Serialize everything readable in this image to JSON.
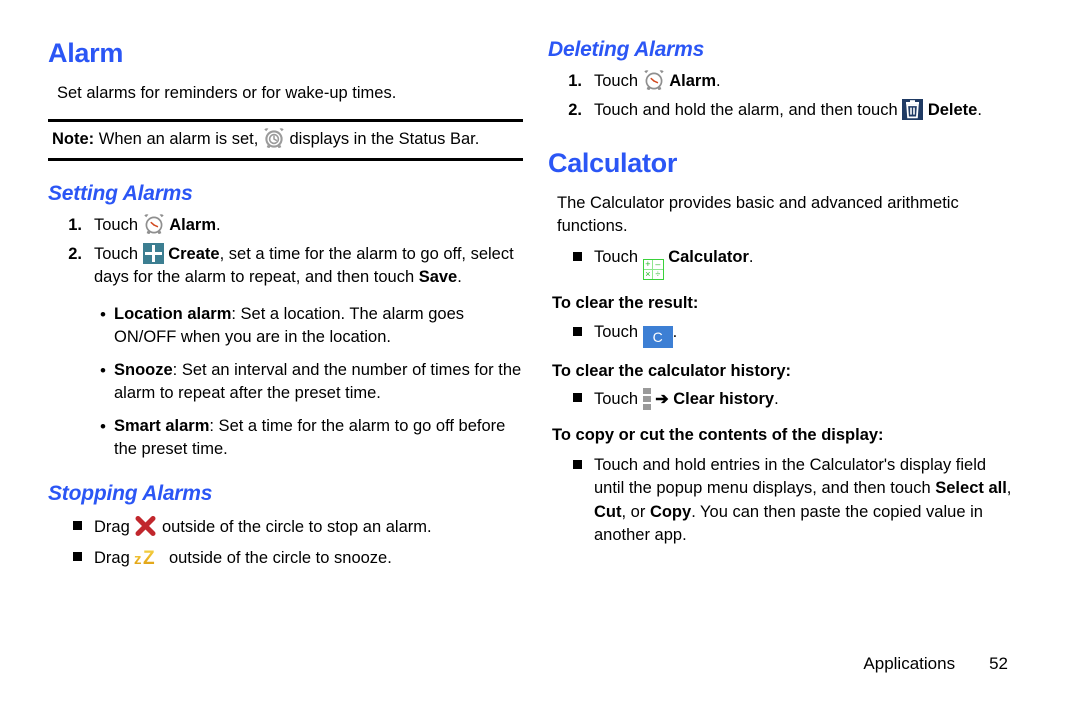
{
  "document": {
    "footer": {
      "section": "Applications",
      "page_number": "52"
    }
  },
  "colors": {
    "heading_blue": "#2b56f5",
    "create_icon": "#3c7e91",
    "delete_icon": "#1f3a63",
    "clear_key": "#3d7fd4",
    "calculator_green": "#3ad13a",
    "snooze_gold": "#e8a91e",
    "stop_red": "#c1272d"
  },
  "left_column": {
    "chapter_title": "Alarm",
    "intro": "Set alarms for reminders or for wake-up times.",
    "note": {
      "label": "Note:",
      "text_before": " When an alarm is set, ",
      "icon": "alarm-clock-icon",
      "text_after": " displays in the Status Bar."
    },
    "setting_alarms": {
      "heading": "Setting Alarms",
      "steps": [
        {
          "number": "1.",
          "pre": "Touch ",
          "icon": "alarm-clock-icon",
          "bold": "Alarm",
          "post": "."
        },
        {
          "number": "2.",
          "pre": "Touch ",
          "icon": "create-plus-icon",
          "bold": "Create",
          "post": ", set a time for the alarm to go off, select days for the alarm to repeat, and then touch ",
          "bold2": "Save",
          "post2": "."
        }
      ],
      "bullets": [
        {
          "term": "Location alarm",
          "text": ": Set a location. The alarm goes ON/OFF when you are in the location."
        },
        {
          "term": "Snooze",
          "text": ": Set an interval and the number of times for the alarm to repeat after the preset time."
        },
        {
          "term": "Smart alarm",
          "text": ": Set a time for the alarm to go off before the preset time."
        }
      ]
    },
    "stopping_alarms": {
      "heading": "Stopping Alarms",
      "items": [
        {
          "pre": "Drag ",
          "icon": "red-x-icon",
          "post": " outside of the circle to stop an alarm."
        },
        {
          "pre": "Drag ",
          "icon": "snooze-zz-icon",
          "post": " outside of the circle to snooze."
        }
      ]
    }
  },
  "right_column": {
    "deleting_alarms": {
      "heading": "Deleting Alarms",
      "steps": [
        {
          "number": "1.",
          "pre": "Touch ",
          "icon": "alarm-clock-icon",
          "bold": "Alarm",
          "post": "."
        },
        {
          "number": "2.",
          "pre": "Touch and hold the alarm, and then touch ",
          "icon": "trash-delete-icon",
          "bold": "Delete",
          "post": "."
        }
      ]
    },
    "calculator": {
      "chapter_title": "Calculator",
      "intro": "The Calculator provides basic and advanced arithmetic functions.",
      "launch_item": {
        "pre": "Touch ",
        "icon": "calculator-icon",
        "bold": "Calculator",
        "post": "."
      },
      "clear_result": {
        "heading": "To clear the result:",
        "item": {
          "pre": "Touch ",
          "icon": "clear-c-key-icon",
          "key_label": "C",
          "post": "."
        }
      },
      "clear_history": {
        "heading": "To clear the calculator history:",
        "item": {
          "pre": "Touch ",
          "icon": "kebab-menu-icon",
          "arrow": "➔",
          "bold": "Clear history",
          "post": "."
        }
      },
      "copy_cut": {
        "heading": "To copy or cut the contents of the display:",
        "item": {
          "pre": "Touch and hold entries in the Calculator's display field until the popup menu displays, and then touch ",
          "bold1": "Select all",
          "mid1": ", ",
          "bold2": "Cut",
          "mid2": ", or ",
          "bold3": "Copy",
          "post": ". You can then paste the copied value in another app."
        }
      }
    }
  }
}
